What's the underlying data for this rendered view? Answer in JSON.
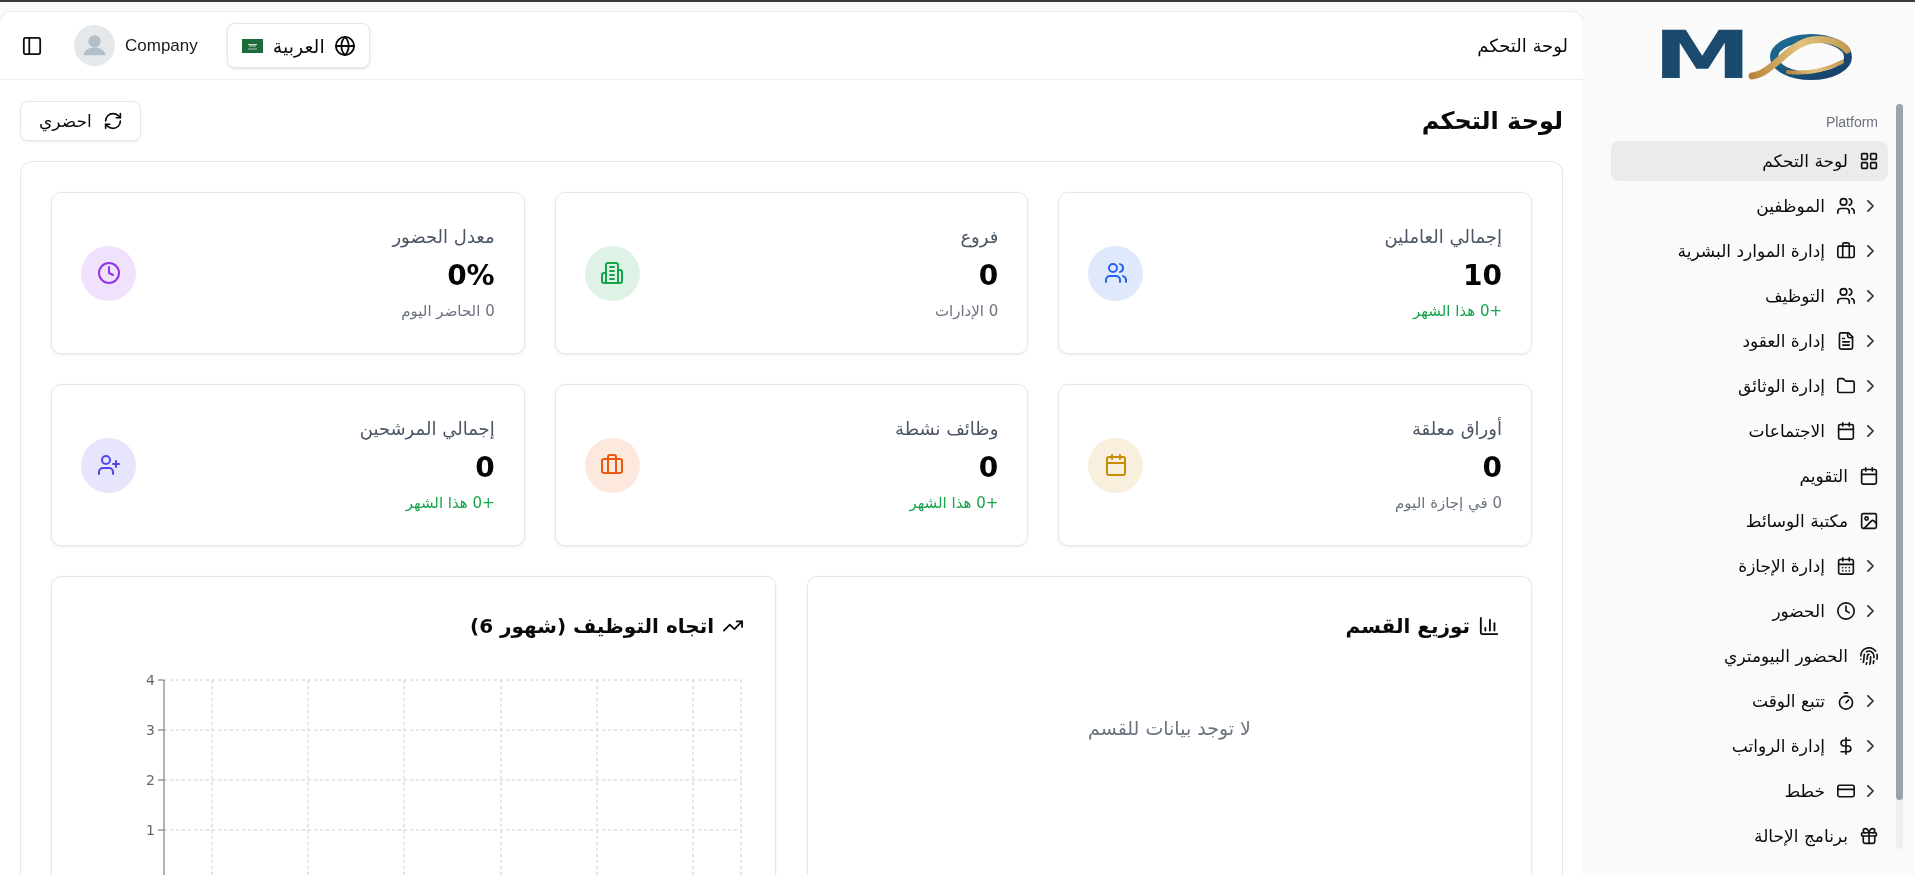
{
  "sidebar": {
    "logo_text": "M",
    "section_label": "Platform",
    "items": [
      {
        "label": "لوحة التحكم",
        "selected": true,
        "expandable": false
      },
      {
        "label": "الموظفين",
        "selected": false,
        "expandable": true
      },
      {
        "label": "إدارة الموارد البشرية",
        "selected": false,
        "expandable": true
      },
      {
        "label": "التوظيف",
        "selected": false,
        "expandable": true
      },
      {
        "label": "إدارة العقود",
        "selected": false,
        "expandable": true
      },
      {
        "label": "إدارة الوثائق",
        "selected": false,
        "expandable": true
      },
      {
        "label": "الاجتماعات",
        "selected": false,
        "expandable": true
      },
      {
        "label": "التقويم",
        "selected": false,
        "expandable": false
      },
      {
        "label": "مكتبة الوسائط",
        "selected": false,
        "expandable": false
      },
      {
        "label": "إدارة الإجازة",
        "selected": false,
        "expandable": true
      },
      {
        "label": "الحضور",
        "selected": false,
        "expandable": true
      },
      {
        "label": "الحضور البيومتري",
        "selected": false,
        "expandable": false
      },
      {
        "label": "تتبع الوقت",
        "selected": false,
        "expandable": true
      },
      {
        "label": "إدارة الرواتب",
        "selected": false,
        "expandable": true
      },
      {
        "label": "خطط",
        "selected": false,
        "expandable": true
      },
      {
        "label": "برنامج الإحالة",
        "selected": false,
        "expandable": false
      }
    ]
  },
  "header": {
    "title": "لوحة التحكم",
    "user_name": "Company",
    "language": "العربية"
  },
  "page": {
    "title": "لوحة التحكم",
    "refresh_button": "احضري"
  },
  "stats": [
    {
      "title": "إجمالي العاملين",
      "value": "10",
      "subtitle": "+0 هذا الشهر",
      "highlighted": true,
      "color": "#2563eb"
    },
    {
      "title": "فروع",
      "value": "0",
      "subtitle": "0 الإدارات",
      "highlighted": false,
      "color": "#16a34a"
    },
    {
      "title": "معدل الحضور",
      "value": "0%",
      "subtitle": "0 الحاضر اليوم",
      "highlighted": false,
      "color": "#9333ea"
    },
    {
      "title": "أوراق معلقة",
      "value": "0",
      "subtitle": "0 في إجازة اليوم",
      "highlighted": false,
      "color": "#ca8a04"
    },
    {
      "title": "وظائف نشطة",
      "value": "0",
      "subtitle": "+0 هذا الشهر",
      "highlighted": true,
      "color": "#ea580c"
    },
    {
      "title": "إجمالي المرشحين",
      "value": "0",
      "subtitle": "+0 هذا الشهر",
      "highlighted": true,
      "color": "#4f46e5"
    }
  ],
  "charts": {
    "department_distribution": {
      "title": "توزيع القسم",
      "empty_message": "لا توجد بيانات للقسم"
    },
    "hiring_trend": {
      "title": "اتجاه التوظيف (شهور 6)",
      "axis_labels": [
        "4",
        "3",
        "2",
        "1"
      ]
    }
  }
}
